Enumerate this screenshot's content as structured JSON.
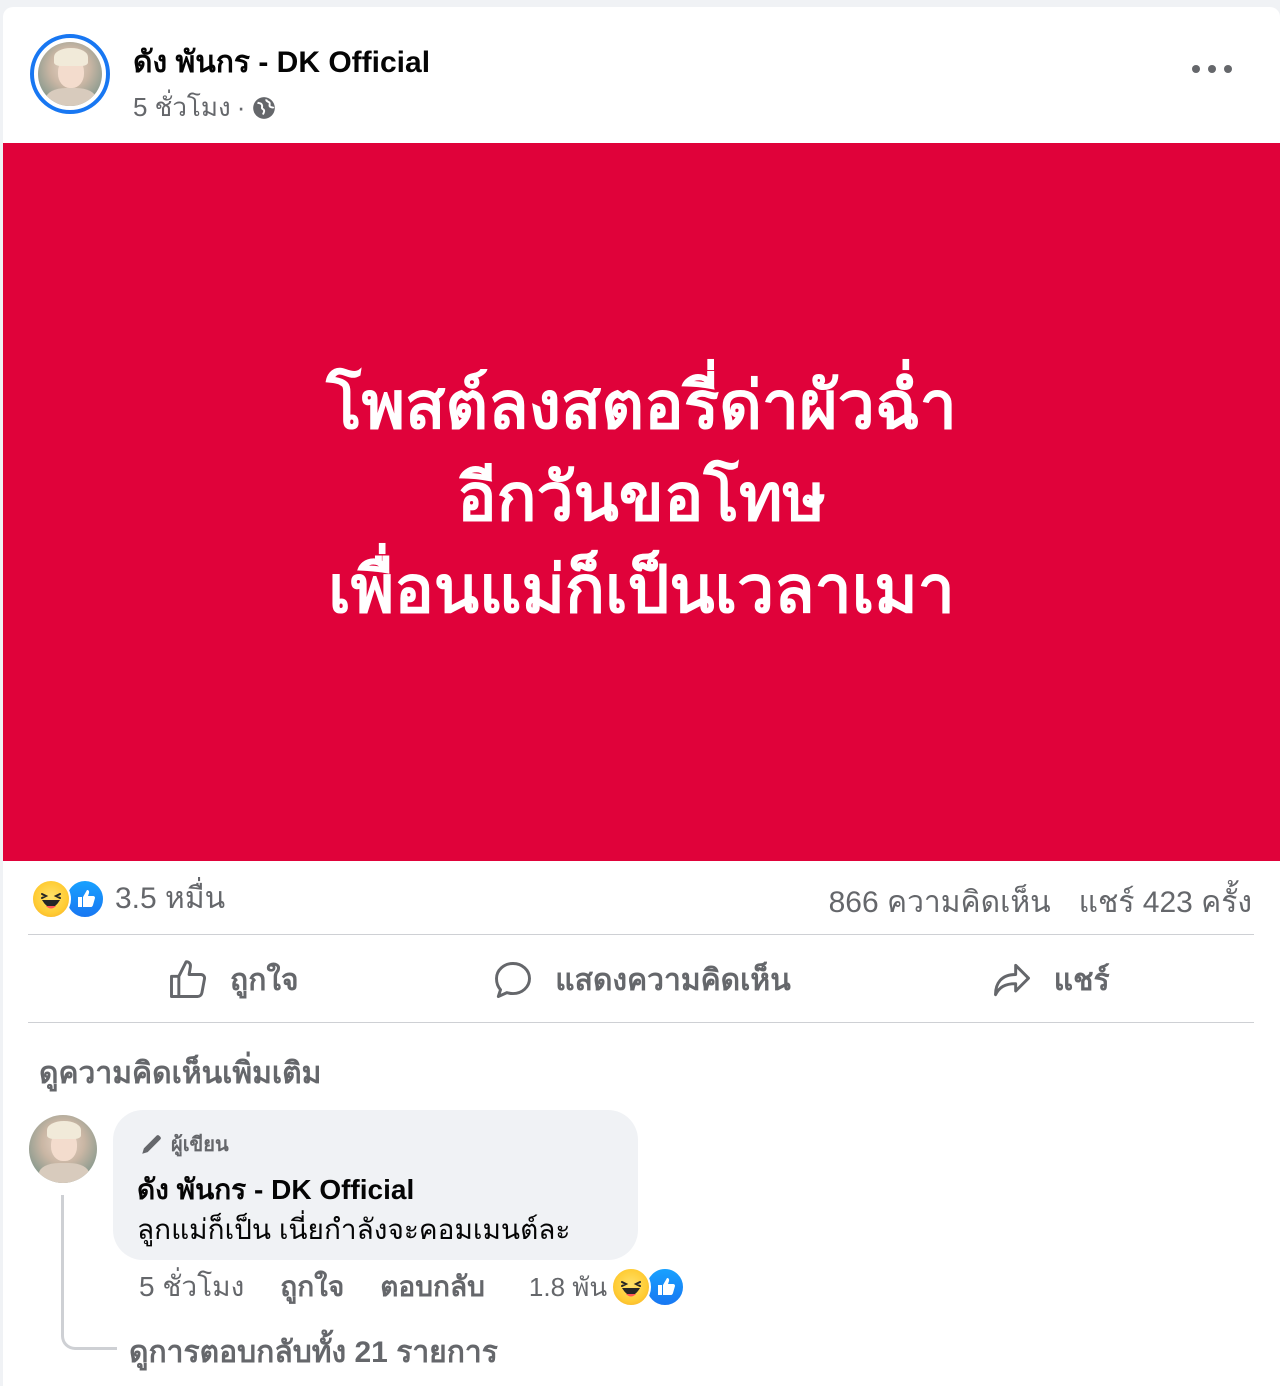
{
  "post": {
    "author": "ดัง พันกร - DK Official",
    "time": "5 ชั่วโมง",
    "separator": "·",
    "privacy_icon": "globe-icon",
    "more_icon": "more-horizontal-icon"
  },
  "media": {
    "background": "#e0023a",
    "lines": [
      "โพสต์ลงสตอรี่ด่าผัวฉ่ำ",
      "อีกวันขอโทษ",
      "เพื่อนแม่ก็เป็นเวลาเมา"
    ]
  },
  "stats": {
    "reaction_icons": [
      "haha-reaction-icon",
      "like-reaction-icon"
    ],
    "reaction_count": "3.5 หมื่น",
    "comments": "866 ความคิดเห็น",
    "shares": "แชร์ 423 ครั้ง"
  },
  "actions": {
    "like": "ถูกใจ",
    "comment": "แสดงความคิดเห็น",
    "share": "แชร์"
  },
  "more_comments": "ดูความคิดเห็นเพิ่มเติม",
  "comment": {
    "badge": "ผู้เขียน",
    "author": "ดัง พันกร - DK Official",
    "text": "ลูกแม่ก็เป็น เนี่ยกำลังจะคอมเมนต์ละ",
    "time": "5 ชั่วโมง",
    "like": "ถูกใจ",
    "reply": "ตอบกลับ",
    "reaction_count": "1.8 พัน",
    "view_replies": "ดูการตอบกลับทั้ง 21 รายการ"
  },
  "colors": {
    "accent": "#1877f2",
    "muted_text": "#65676b",
    "bubble": "#f0f2f5"
  }
}
